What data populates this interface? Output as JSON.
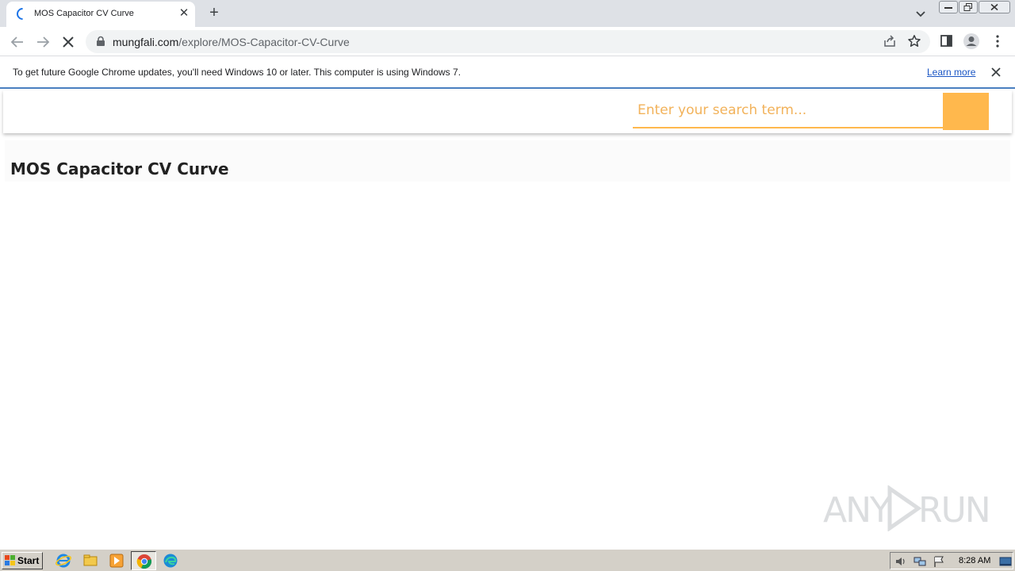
{
  "browser": {
    "tab": {
      "title": "MOS Capacitor CV Curve"
    },
    "address": {
      "host": "mungfali.com",
      "path": "/explore/MOS-Capacitor-CV-Curve"
    },
    "infobar": {
      "message": "To get future Google Chrome updates, you'll need Windows 10 or later. This computer is using Windows 7.",
      "link": "Learn more"
    }
  },
  "page": {
    "search": {
      "placeholder": "Enter your search term..."
    },
    "title": "MOS Capacitor CV Curve",
    "accent_color": "#ffb84d"
  },
  "watermark": {
    "left": "ANY",
    "right": "RUN"
  },
  "taskbar": {
    "start": "Start",
    "clock": "8:28 AM"
  }
}
